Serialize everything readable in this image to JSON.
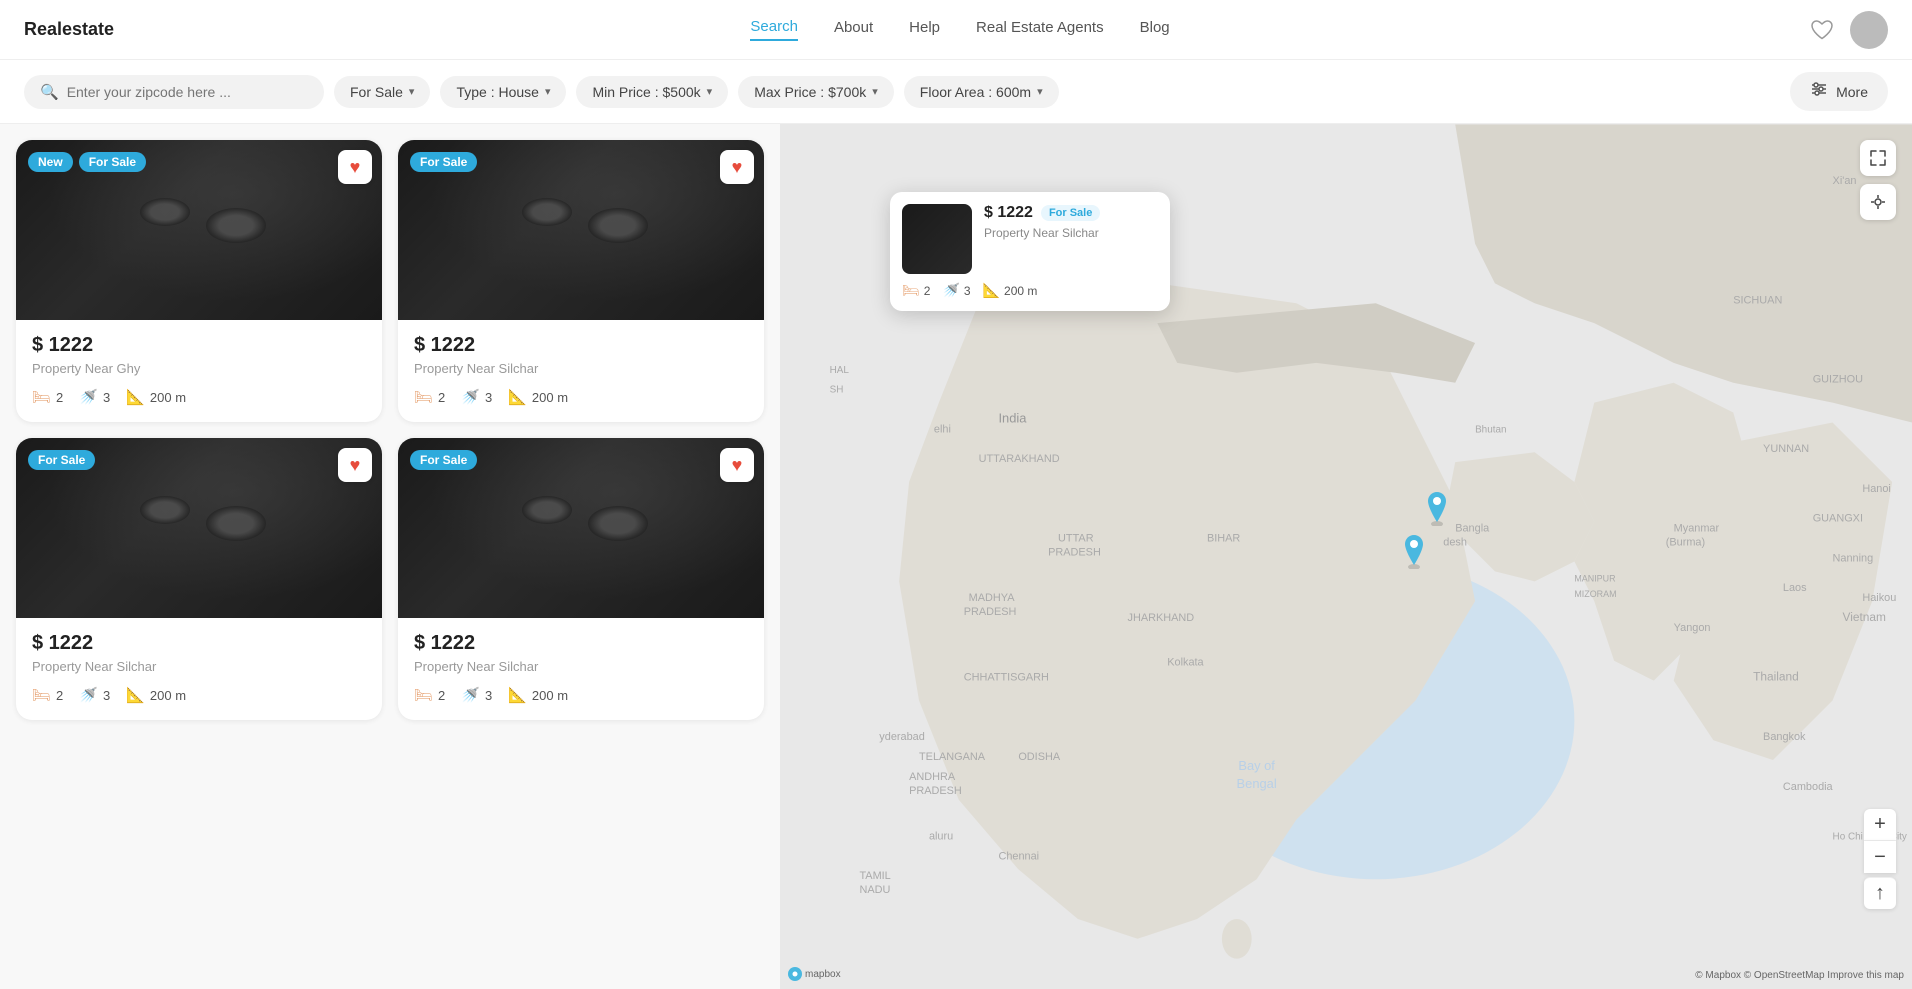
{
  "brand": "Realestate",
  "navbar": {
    "links": [
      {
        "id": "search",
        "label": "Search",
        "active": true
      },
      {
        "id": "about",
        "label": "About",
        "active": false
      },
      {
        "id": "help",
        "label": "Help",
        "active": false
      },
      {
        "id": "agents",
        "label": "Real Estate Agents",
        "active": false
      },
      {
        "id": "blog",
        "label": "Blog",
        "active": false
      }
    ]
  },
  "filters": {
    "search_placeholder": "Enter your zipcode here ...",
    "for_sale_label": "For Sale",
    "type_label": "Type : House",
    "min_price_label": "Min Price : $500k",
    "max_price_label": "Max Price : $700k",
    "floor_area_label": "Floor Area : 600m",
    "more_label": "More"
  },
  "listings": [
    {
      "id": 1,
      "badges": [
        "New",
        "For Sale"
      ],
      "price": "$ 1222",
      "location": "Property Near Ghy",
      "beds": 2,
      "baths": 3,
      "area": "200 m",
      "favorited": true
    },
    {
      "id": 2,
      "badges": [
        "For Sale"
      ],
      "price": "$ 1222",
      "location": "Property Near Silchar",
      "beds": 2,
      "baths": 3,
      "area": "200 m",
      "favorited": true
    },
    {
      "id": 3,
      "badges": [
        "For Sale"
      ],
      "price": "$ 1222",
      "location": "Property Near Silchar",
      "beds": 2,
      "baths": 3,
      "area": "200 m",
      "favorited": true
    },
    {
      "id": 4,
      "badges": [
        "For Sale"
      ],
      "price": "$ 1222",
      "location": "Property Near Silchar",
      "beds": 2,
      "baths": 3,
      "area": "200 m",
      "favorited": true
    }
  ],
  "map_popup": {
    "price": "$ 1222",
    "badge": "For Sale",
    "description": "Property Near Silchar",
    "beds": 2,
    "baths": 3,
    "area": "200 m"
  },
  "map": {
    "attribution": "© Mapbox © OpenStreetMap Improve this map",
    "logo": "mapbox"
  },
  "icons": {
    "search": "🔍",
    "heart_filled": "♥",
    "heart_outline": "♡",
    "bed": "🛏",
    "bath": "🚿",
    "area": "📐",
    "chevron_down": "▾",
    "more_sliders": "⊞",
    "expand": "⤢",
    "location": "◉",
    "zoom_in": "+",
    "zoom_out": "−",
    "compass": "⊕"
  }
}
